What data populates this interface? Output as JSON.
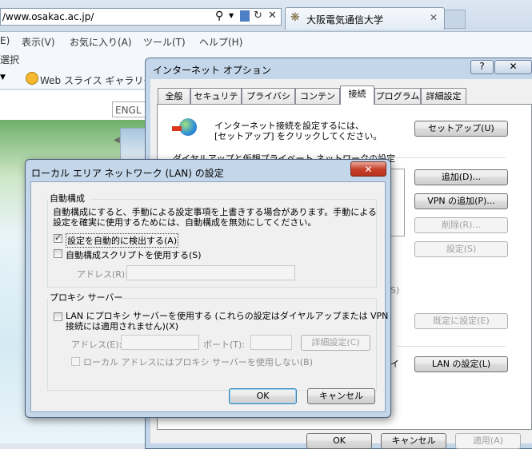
{
  "browser": {
    "address_url": "/www.osakac.ac.jp/",
    "tab_title": "大阪電気通信大学",
    "menu": [
      "E)",
      "表示(V)",
      "お気に入り(A)",
      "ツール(T)",
      "ヘルプ(H)"
    ],
    "selection_text": "選択",
    "favorites_bar_item": "Web スライス ギャラリー",
    "english_link": "ENGL"
  },
  "options_dialog": {
    "title": "インターネット オプション",
    "help_glyph": "?",
    "close_glyph": "✕",
    "tabs": [
      "全般",
      "セキュリティ",
      "プライバシー",
      "コンテンツ",
      "接続",
      "プログラム",
      "詳細設定"
    ],
    "active_tab_index": 4,
    "setup_text_line1": "インターネット接続を設定するには、",
    "setup_text_line2": "[セットアップ] をクリックしてください。",
    "setup_button": "セットアップ(U)",
    "dialup_section_label": "ダイヤルアップと仮想プライベート ネットワークの設定",
    "add_button": "追加(D)...",
    "add_vpn_button": "VPN の追加(P)...",
    "remove_button": "削除(R)...",
    "settings_button": "設定(S)",
    "partial_s": "S)",
    "set_default_button": "既定に設定(E)",
    "partial_i": "イ",
    "lan_settings_button": "LAN の設定(L)",
    "ok_button": "OK",
    "cancel_button": "キャンセル",
    "apply_button": "適用(A)"
  },
  "lan_dialog": {
    "title": "ローカル エリア ネットワーク (LAN) の設定",
    "close_glyph": "✕",
    "auto_config_group": "自動構成",
    "auto_config_desc_line1": "自動構成にすると、手動による設定事項を上書きする場合があります。手動による",
    "auto_config_desc_line2": "設定を確実に使用するためには、自動構成を無効にしてください。",
    "auto_detect_label": "設定を自動的に検出する(A)",
    "auto_detect_checked": true,
    "auto_script_label": "自動構成スクリプトを使用する(S)",
    "auto_script_checked": false,
    "address_label": "アドレス(R):",
    "address_value": "",
    "proxy_group": "プロキシ サーバー",
    "use_proxy_line1": "LAN にプロキシ サーバーを使用する (これらの設定はダイヤルアップまたは VPN",
    "use_proxy_line2": "接続には適用されません)(X)",
    "use_proxy_checked": false,
    "proxy_address_label": "アドレス(E):",
    "proxy_address_value": "",
    "port_label": "ポート(T):",
    "port_value": "",
    "advanced_button": "詳細設定(C)",
    "bypass_local_label": "ローカル アドレスにはプロキシ サーバーを使用しない(B)",
    "bypass_local_checked": false,
    "ok_button": "OK",
    "cancel_button": "キャンセル"
  }
}
